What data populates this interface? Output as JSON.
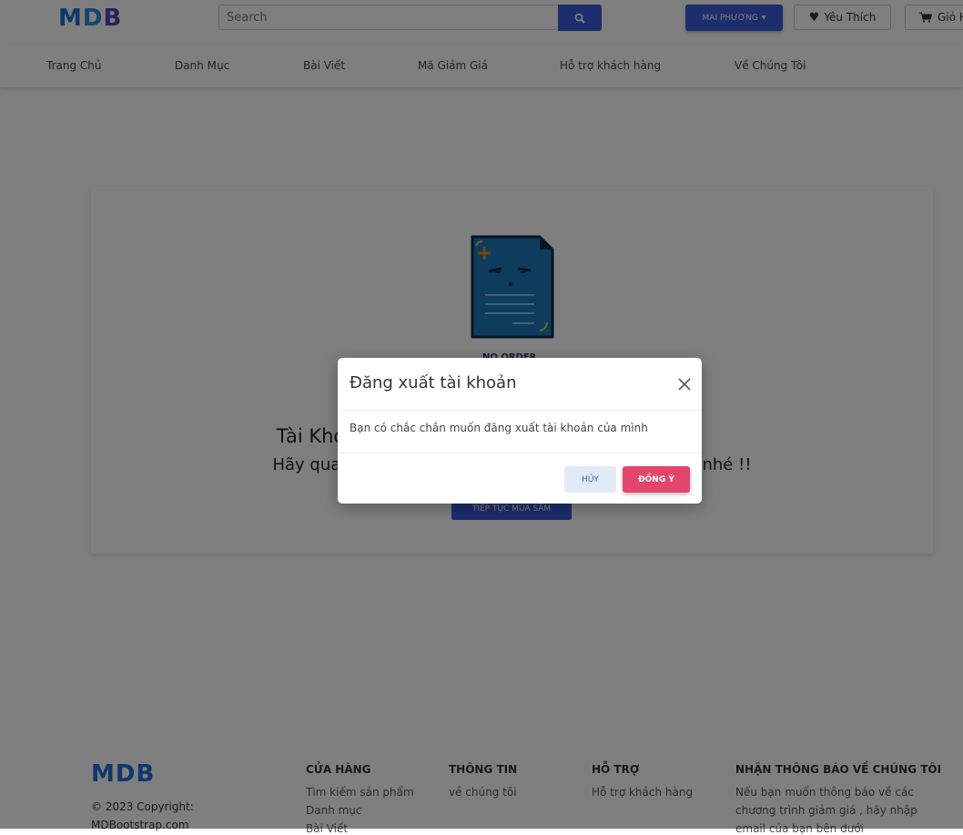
{
  "header": {
    "logo": {
      "m": "M",
      "d": "D",
      "b": "B"
    },
    "search_placeholder": "Search",
    "user_button": "MAI PHƯƠNG",
    "favorites": "Yêu Thích",
    "cart": "Giỏ H"
  },
  "nav": [
    "Trang Chủ",
    "Danh Mục",
    "Bài Viết",
    "Mã Giảm Giá",
    "Hỗ trợ khách hàng",
    "Về Chúng Tôi"
  ],
  "main": {
    "no_order": "NO ORDER",
    "title": "Tài Khoản Của Bạn Chưa Có Đơn Hàng Nào",
    "subtitle": "Hãy quay lại cửa hàng để tiếp tục mua sắm và mua nhé !!",
    "continue_button": "TIẾP TỤC MUA SẮM"
  },
  "footer": {
    "logo": "MDB",
    "copyright": "© 2023 Copyright: MDBootstrap.com",
    "columns": [
      {
        "heading": "CỬA HÀNG",
        "links": [
          "Tìm kiếm sản phẩm",
          "Danh mục",
          "Bài Viết"
        ]
      },
      {
        "heading": "THÔNG TIN",
        "links": [
          "về chúng tôi"
        ]
      },
      {
        "heading": "HỖ TRỢ",
        "links": [
          "Hỗ trợ khách hàng"
        ]
      },
      {
        "heading": "NHẬN THÔNG BÁO VỀ CHÚNG TÔI",
        "links": [
          "Nếu bạn muốn thông báo về các",
          "chương trình giảm giá , hãy nhập",
          "email của bạn bên dưới"
        ]
      }
    ]
  },
  "modal": {
    "title": "Đăng xuất tài khoản",
    "body": "Bạn có chắc chắn muốn đăng xuất tài khoản của mình",
    "cancel": "HỦY",
    "confirm": "ĐỒNG Ý"
  },
  "colors": {
    "primary": "#3b5bdb",
    "danger": "#e4466b",
    "overlay": "rgba(0,0,0,0.5)"
  },
  "icons": [
    "search-icon",
    "heart-icon",
    "cart-icon",
    "caret-down-icon",
    "close-icon",
    "document-icon"
  ]
}
